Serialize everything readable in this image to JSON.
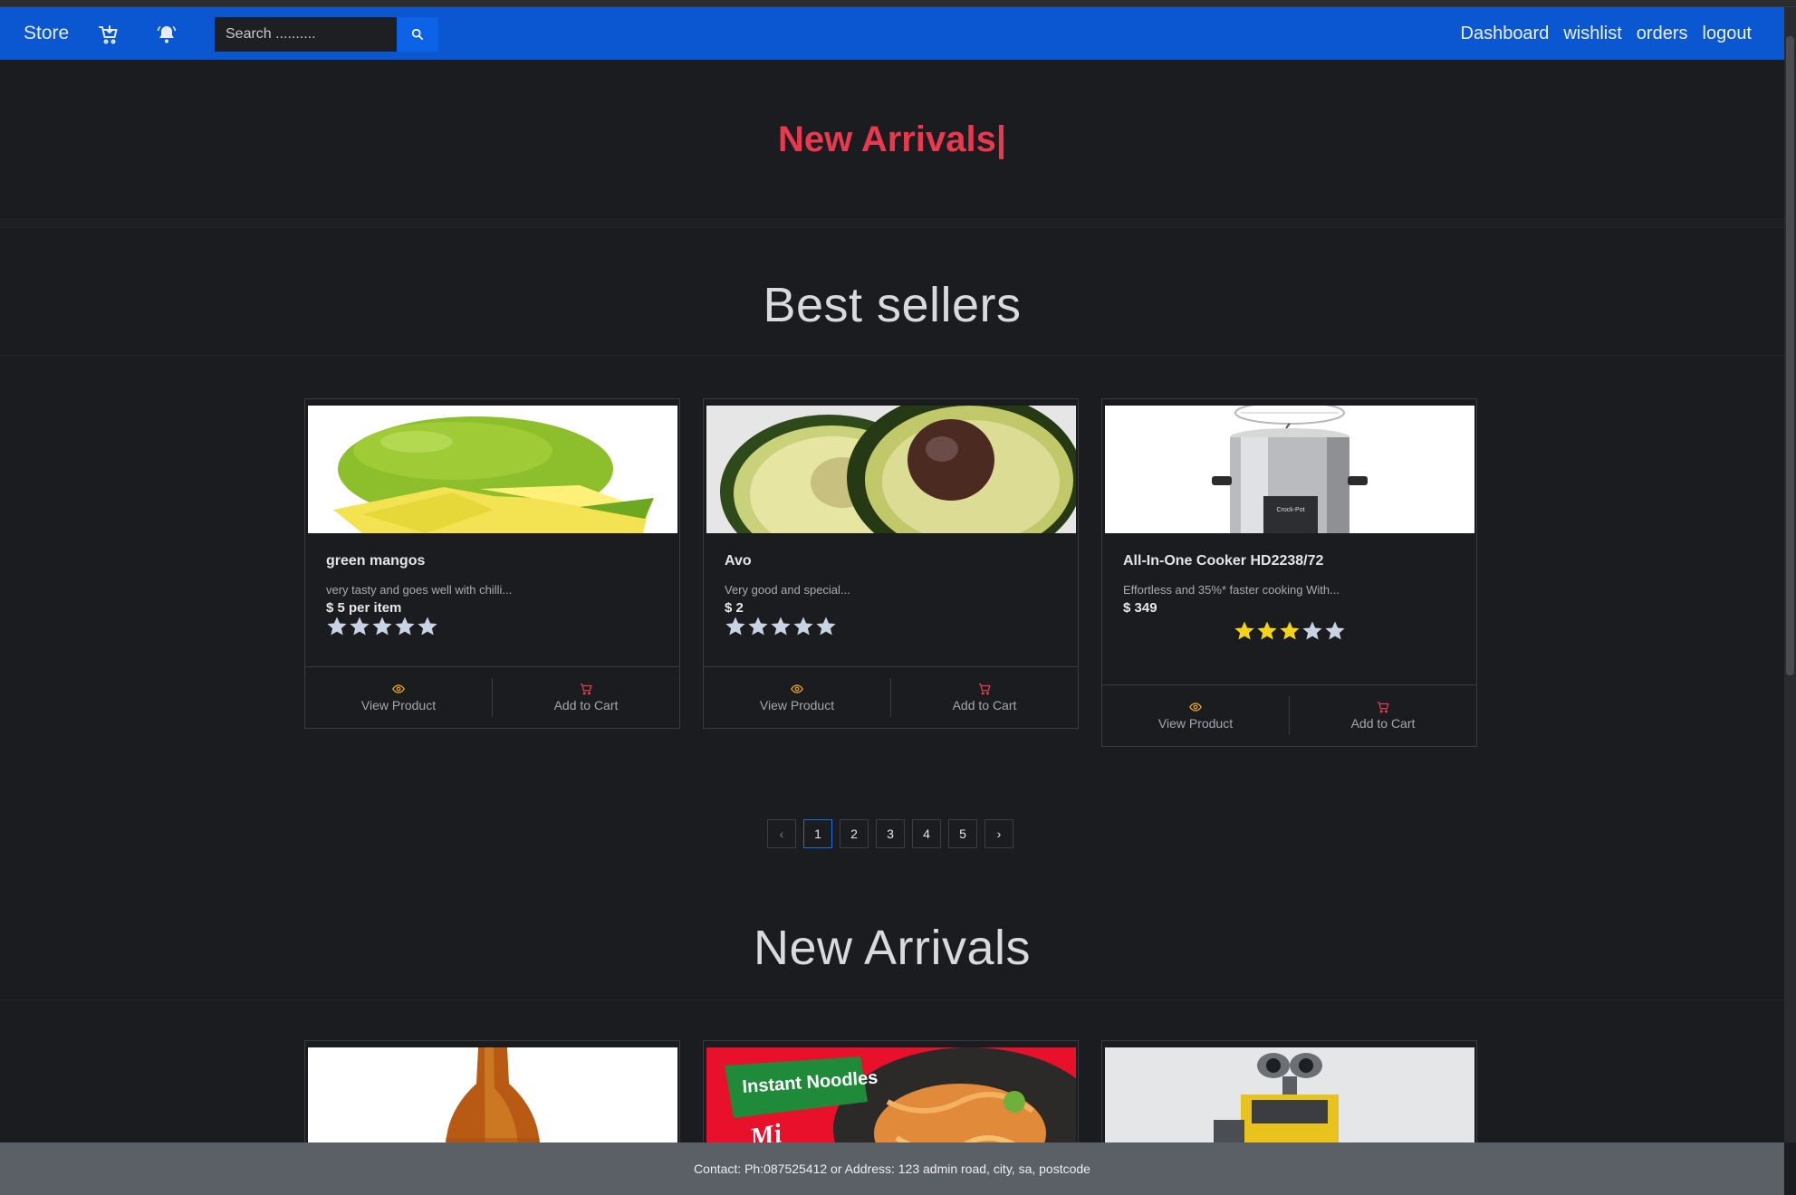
{
  "navbar": {
    "brand": "Store",
    "search": {
      "placeholder": "Search ..........",
      "value": ""
    },
    "links": [
      "Dashboard",
      "wishlist",
      "orders",
      "logout"
    ]
  },
  "hero": {
    "title": "New Arrivals|"
  },
  "sections": {
    "best_sellers_title": "Best sellers",
    "new_arrivals_title": "New Arrivals"
  },
  "best_sellers": [
    {
      "name": "green mangos",
      "description": "very tasty and goes well with chilli...",
      "price": "$ 5 per item",
      "rating": 0,
      "image": "mango-image"
    },
    {
      "name": "Avo",
      "description": "Very good and special...",
      "price": "$ 2",
      "rating": 0,
      "image": "avocado-image"
    },
    {
      "name": "All-In-One Cooker HD2238/72",
      "description": "Effortless and 35%* faster cooking With...",
      "price": "$ 349",
      "rating": 3,
      "image": "cooker-image"
    }
  ],
  "card_actions": {
    "view": "View Product",
    "add": "Add to Cart"
  },
  "pagination": {
    "pages": [
      "1",
      "2",
      "3",
      "4",
      "5"
    ],
    "current": "1",
    "prev": "‹",
    "next": "›"
  },
  "new_arrivals": [
    {
      "image": "beer-bottle-image"
    },
    {
      "image": "instant-noodles-image",
      "label": "Instant Noodles"
    },
    {
      "image": "robot-toy-image"
    }
  ],
  "footer": {
    "text": "Contact: Ph:087525412 or Address: 123 admin road, city, sa, postcode"
  },
  "colors": {
    "navbar": "#0b56d1",
    "hero_title": "#e8394f",
    "star_filled": "#f5d21b",
    "star_empty": "#c9d3e3",
    "footer": "#5b6067"
  }
}
